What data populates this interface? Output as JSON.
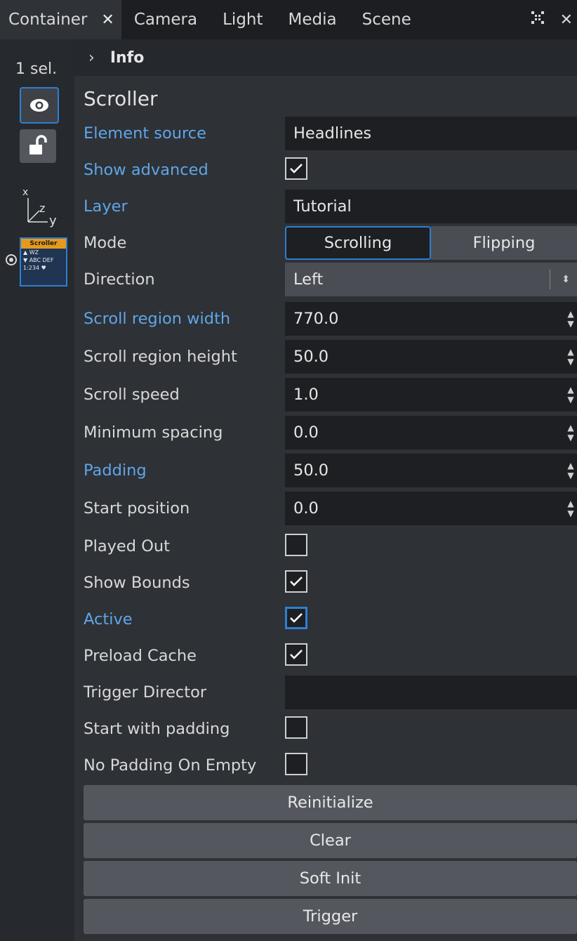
{
  "tabs": [
    {
      "label": "Container",
      "active": true
    },
    {
      "label": "Camera"
    },
    {
      "label": "Light"
    },
    {
      "label": "Media"
    },
    {
      "label": "Scene"
    }
  ],
  "leftbar": {
    "selection_count": "1 sel.",
    "thumbnail": {
      "title": "Scroller",
      "line1": "▲ WZ",
      "line2": "▼ ABC  DEF",
      "line3": "1:234 ♥"
    }
  },
  "panel": {
    "info_label": "Info",
    "section_title": "Scroller",
    "element_source": {
      "label": "Element source",
      "value": "Headlines"
    },
    "show_advanced": {
      "label": "Show advanced",
      "checked": true
    },
    "layer": {
      "label": "Layer",
      "value": "Tutorial"
    },
    "mode": {
      "label": "Mode",
      "options": [
        "Scrolling",
        "Flipping"
      ],
      "selected": "Scrolling"
    },
    "direction": {
      "label": "Direction",
      "value": "Left"
    },
    "scroll_region_width": {
      "label": "Scroll region width",
      "value": "770.0"
    },
    "scroll_region_height": {
      "label": "Scroll region height",
      "value": "50.0"
    },
    "scroll_speed": {
      "label": "Scroll speed",
      "value": "1.0"
    },
    "minimum_spacing": {
      "label": "Minimum spacing",
      "value": "0.0"
    },
    "padding": {
      "label": "Padding",
      "value": "50.0"
    },
    "start_position": {
      "label": "Start position",
      "value": "0.0"
    },
    "played_out": {
      "label": "Played Out",
      "checked": false
    },
    "show_bounds": {
      "label": "Show Bounds",
      "checked": true
    },
    "active": {
      "label": "Active",
      "checked": true
    },
    "preload_cache": {
      "label": "Preload Cache",
      "checked": true
    },
    "trigger_director": {
      "label": "Trigger Director",
      "value": ""
    },
    "start_with_padding": {
      "label": "Start with padding",
      "checked": false
    },
    "no_padding_on_empty": {
      "label": "No Padding On Empty",
      "checked": false
    },
    "buttons": {
      "reinitialize": "Reinitialize",
      "clear": "Clear",
      "soft_init": "Soft Init",
      "trigger": "Trigger"
    }
  },
  "colors": {
    "accent": "#2f7fd3",
    "link_label": "#5fa6e8",
    "background": "#2e3136"
  }
}
